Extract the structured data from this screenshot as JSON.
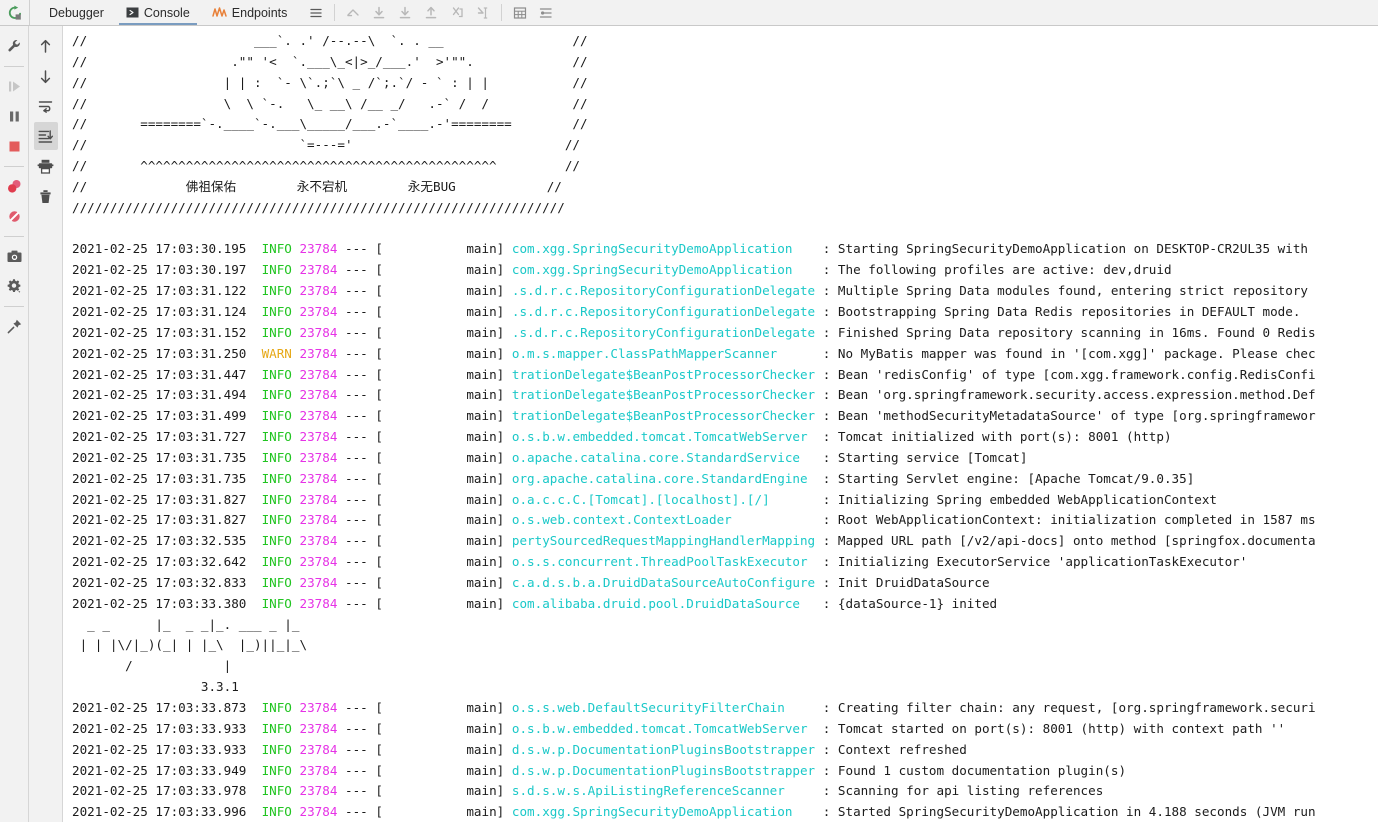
{
  "toolbar": {
    "rerun_icon": "rerun-icon",
    "tabs": [
      {
        "label": "Debugger",
        "icon": "",
        "active": false
      },
      {
        "label": "Console",
        "icon": "console-icon",
        "active": true
      },
      {
        "label": "Endpoints",
        "icon": "endpoints-icon",
        "active": false
      }
    ],
    "menu_icon": "hamburger-menu-icon",
    "step_buttons": [
      "show-execution-point-icon",
      "step-over-icon",
      "step-into-icon",
      "step-out-icon",
      "drop-frame-icon",
      "run-to-cursor-icon"
    ],
    "right_buttons": [
      "evaluate-table-icon",
      "settings-lines-icon"
    ]
  },
  "left_gutter": {
    "items": [
      "wrench-icon",
      "resume-program-icon",
      "pause-program-icon",
      "stop-program-icon",
      "view-breakpoints-icon",
      "mute-breakpoints-icon",
      "screenshot-icon",
      "settings-gear-icon",
      "pin-tab-icon"
    ]
  },
  "right_gutter": {
    "items": [
      "scroll-up-icon",
      "scroll-down-icon",
      "soft-wrap-icon",
      "scroll-to-end-icon",
      "print-icon",
      "clear-all-icon"
    ],
    "selected": "scroll-to-end-icon"
  },
  "console": {
    "banner_buddha": [
      "//                      ___`. .' /--.--\\  `. . __                 //",
      "//                   .\"\" '<  `.___\\_<|>_/___.'  >'\"\".             //",
      "//                  | | :  `- \\`.;`\\ _ /`;.`/ - ` : | |           //",
      "//                  \\  \\ `-.   \\_ __\\ /__ _/   .-` /  /           //",
      "//       ========`-.____`-.___\\_____/___.-`____.-'========        //",
      "//                            `=---='                            //",
      "//       ^^^^^^^^^^^^^^^^^^^^^^^^^^^^^^^^^^^^^^^^^^^^^^^         //",
      "//             佛祖保佑        永不宕机        永无BUG            //",
      "/////////////////////////////////////////////////////////////////"
    ],
    "buddha_line_chinese": {
      "a": "佛祖保佑",
      "b": "永不宕机",
      "c": "永无BUG"
    },
    "druid_banner": [
      "  _ _      |_  _ _|_. ___ _ |_",
      " | | |\\/|_)(_| | |_\\  |_)||_|_\\",
      "       /            |",
      "                 3.3.1"
    ],
    "druid_version": "3.3.1",
    "log_lines": [
      {
        "time": "2021-02-25 17:03:30.195",
        "level": "INFO",
        "pid": "23784",
        "thread": "main",
        "logger": "com.xgg.SpringSecurityDemoApplication",
        "message": "Starting SpringSecurityDemoApplication on DESKTOP-CR2UL35 with"
      },
      {
        "time": "2021-02-25 17:03:30.197",
        "level": "INFO",
        "pid": "23784",
        "thread": "main",
        "logger": "com.xgg.SpringSecurityDemoApplication",
        "message": "The following profiles are active: dev,druid"
      },
      {
        "time": "2021-02-25 17:03:31.122",
        "level": "INFO",
        "pid": "23784",
        "thread": "main",
        "logger": ".s.d.r.c.RepositoryConfigurationDelegate",
        "message": "Multiple Spring Data modules found, entering strict repository"
      },
      {
        "time": "2021-02-25 17:03:31.124",
        "level": "INFO",
        "pid": "23784",
        "thread": "main",
        "logger": ".s.d.r.c.RepositoryConfigurationDelegate",
        "message": "Bootstrapping Spring Data Redis repositories in DEFAULT mode."
      },
      {
        "time": "2021-02-25 17:03:31.152",
        "level": "INFO",
        "pid": "23784",
        "thread": "main",
        "logger": ".s.d.r.c.RepositoryConfigurationDelegate",
        "message": "Finished Spring Data repository scanning in 16ms. Found 0 Redis"
      },
      {
        "time": "2021-02-25 17:03:31.250",
        "level": "WARN",
        "pid": "23784",
        "thread": "main",
        "logger": "o.m.s.mapper.ClassPathMapperScanner",
        "message": "No MyBatis mapper was found in '[com.xgg]' package. Please chec"
      },
      {
        "time": "2021-02-25 17:03:31.447",
        "level": "INFO",
        "pid": "23784",
        "thread": "main",
        "logger": "trationDelegate$BeanPostProcessorChecker",
        "message": "Bean 'redisConfig' of type [com.xgg.framework.config.RedisConfi"
      },
      {
        "time": "2021-02-25 17:03:31.494",
        "level": "INFO",
        "pid": "23784",
        "thread": "main",
        "logger": "trationDelegate$BeanPostProcessorChecker",
        "message": "Bean 'org.springframework.security.access.expression.method.Def"
      },
      {
        "time": "2021-02-25 17:03:31.499",
        "level": "INFO",
        "pid": "23784",
        "thread": "main",
        "logger": "trationDelegate$BeanPostProcessorChecker",
        "message": "Bean 'methodSecurityMetadataSource' of type [org.springframewor"
      },
      {
        "time": "2021-02-25 17:03:31.727",
        "level": "INFO",
        "pid": "23784",
        "thread": "main",
        "logger": "o.s.b.w.embedded.tomcat.TomcatWebServer",
        "message": "Tomcat initialized with port(s): 8001 (http)"
      },
      {
        "time": "2021-02-25 17:03:31.735",
        "level": "INFO",
        "pid": "23784",
        "thread": "main",
        "logger": "o.apache.catalina.core.StandardService",
        "message": "Starting service [Tomcat]"
      },
      {
        "time": "2021-02-25 17:03:31.735",
        "level": "INFO",
        "pid": "23784",
        "thread": "main",
        "logger": "org.apache.catalina.core.StandardEngine",
        "message": "Starting Servlet engine: [Apache Tomcat/9.0.35]"
      },
      {
        "time": "2021-02-25 17:03:31.827",
        "level": "INFO",
        "pid": "23784",
        "thread": "main",
        "logger": "o.a.c.c.C.[Tomcat].[localhost].[/]",
        "message": "Initializing Spring embedded WebApplicationContext"
      },
      {
        "time": "2021-02-25 17:03:31.827",
        "level": "INFO",
        "pid": "23784",
        "thread": "main",
        "logger": "o.s.web.context.ContextLoader",
        "message": "Root WebApplicationContext: initialization completed in 1587 ms"
      },
      {
        "time": "2021-02-25 17:03:32.535",
        "level": "INFO",
        "pid": "23784",
        "thread": "main",
        "logger": "pertySourcedRequestMappingHandlerMapping",
        "message": "Mapped URL path [/v2/api-docs] onto method [springfox.documenta"
      },
      {
        "time": "2021-02-25 17:03:32.642",
        "level": "INFO",
        "pid": "23784",
        "thread": "main",
        "logger": "o.s.s.concurrent.ThreadPoolTaskExecutor",
        "message": "Initializing ExecutorService 'applicationTaskExecutor'"
      },
      {
        "time": "2021-02-25 17:03:32.833",
        "level": "INFO",
        "pid": "23784",
        "thread": "main",
        "logger": "c.a.d.s.b.a.DruidDataSourceAutoConfigure",
        "message": "Init DruidDataSource"
      },
      {
        "time": "2021-02-25 17:03:33.380",
        "level": "INFO",
        "pid": "23784",
        "thread": "main",
        "logger": "com.alibaba.druid.pool.DruidDataSource",
        "message": "{dataSource-1} inited"
      }
    ],
    "log_lines_after_banner": [
      {
        "time": "2021-02-25 17:03:33.873",
        "level": "INFO",
        "pid": "23784",
        "thread": "main",
        "logger": "o.s.s.web.DefaultSecurityFilterChain",
        "message": "Creating filter chain: any request, [org.springframework.securi"
      },
      {
        "time": "2021-02-25 17:03:33.933",
        "level": "INFO",
        "pid": "23784",
        "thread": "main",
        "logger": "o.s.b.w.embedded.tomcat.TomcatWebServer",
        "message": "Tomcat started on port(s): 8001 (http) with context path ''"
      },
      {
        "time": "2021-02-25 17:03:33.933",
        "level": "INFO",
        "pid": "23784",
        "thread": "main",
        "logger": "d.s.w.p.DocumentationPluginsBootstrapper",
        "message": "Context refreshed"
      },
      {
        "time": "2021-02-25 17:03:33.949",
        "level": "INFO",
        "pid": "23784",
        "thread": "main",
        "logger": "d.s.w.p.DocumentationPluginsBootstrapper",
        "message": "Found 1 custom documentation plugin(s)"
      },
      {
        "time": "2021-02-25 17:03:33.978",
        "level": "INFO",
        "pid": "23784",
        "thread": "main",
        "logger": "s.d.s.w.s.ApiListingReferenceScanner",
        "message": "Scanning for api listing references"
      },
      {
        "time": "2021-02-25 17:03:33.996",
        "level": "INFO",
        "pid": "23784",
        "thread": "main",
        "logger": "com.xgg.SpringSecurityDemoApplication",
        "message": "Started SpringSecurityDemoApplication in 4.188 seconds (JVM run"
      }
    ]
  },
  "colors": {
    "info": "#21c421",
    "warn": "#e6a817",
    "pid": "#e632e6",
    "logger": "#1ac8c8",
    "text": "#1b1b1b",
    "toolbar_bg": "#f2f2f2",
    "tab_underline": "#7a9cc0",
    "stop_red": "#e35c5c",
    "rerun_green": "#4a9c5c",
    "endpoints_orange": "#e8813a"
  }
}
